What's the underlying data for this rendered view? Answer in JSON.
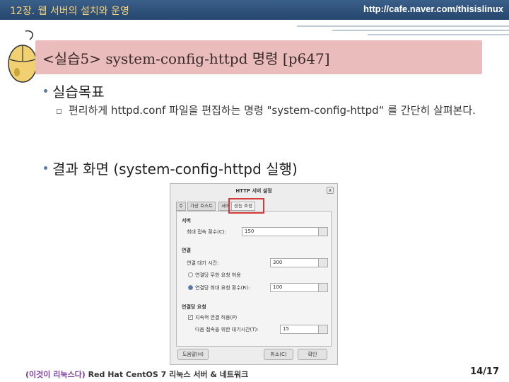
{
  "header": {
    "chapter": "12장. 웹 서버의 설치와 운영",
    "url": "http://cafe.naver.com/thisislinux"
  },
  "title": "<실습5> system-config-httpd 명령 [p647]",
  "bullets": [
    {
      "text": "실습목표",
      "sub": "편리하게 httpd.conf 파일을 편집하는 명령 \"system-config-httpd“ 를 간단히 살펴본다."
    },
    {
      "text": "결과 화면 (system-config-httpd 실행)"
    }
  ],
  "dialog": {
    "title": "HTTP 서버 설정",
    "close": "x",
    "tabs": [
      "주",
      "가상 호스트",
      "서버",
      "성능 조정"
    ],
    "server_section": "서버",
    "max_connections_label": "최대 접속 횟수(C):",
    "max_connections_value": "150",
    "connection_section": "연결",
    "timeout_label": "연결 대기 시간:",
    "timeout_value": "300",
    "unlimited_label": "연결당 무한 요청 허용",
    "max_requests_label": "연결당 최대 요청 횟수(R):",
    "max_requests_value": "100",
    "request_section": "연결당 요청",
    "keepalive_label": "지속적 연결 허용(P)",
    "keepalive_timeout_label": "다음 접속을 위한 대기시간(T):",
    "keepalive_timeout_value": "15",
    "help_button": "도움말(H)",
    "cancel_button": "취소(C)",
    "ok_button": "확인"
  },
  "footer": {
    "highlight": "(이것이 리눅스다)",
    "rest": " Red Hat CentOS 7 리눅스 서버 & 네트워크",
    "page": "14/17"
  },
  "colors": {
    "header_bg": "#2f5580",
    "title_bg": "#ebbcbc",
    "highlight_box": "#d63a3a"
  }
}
